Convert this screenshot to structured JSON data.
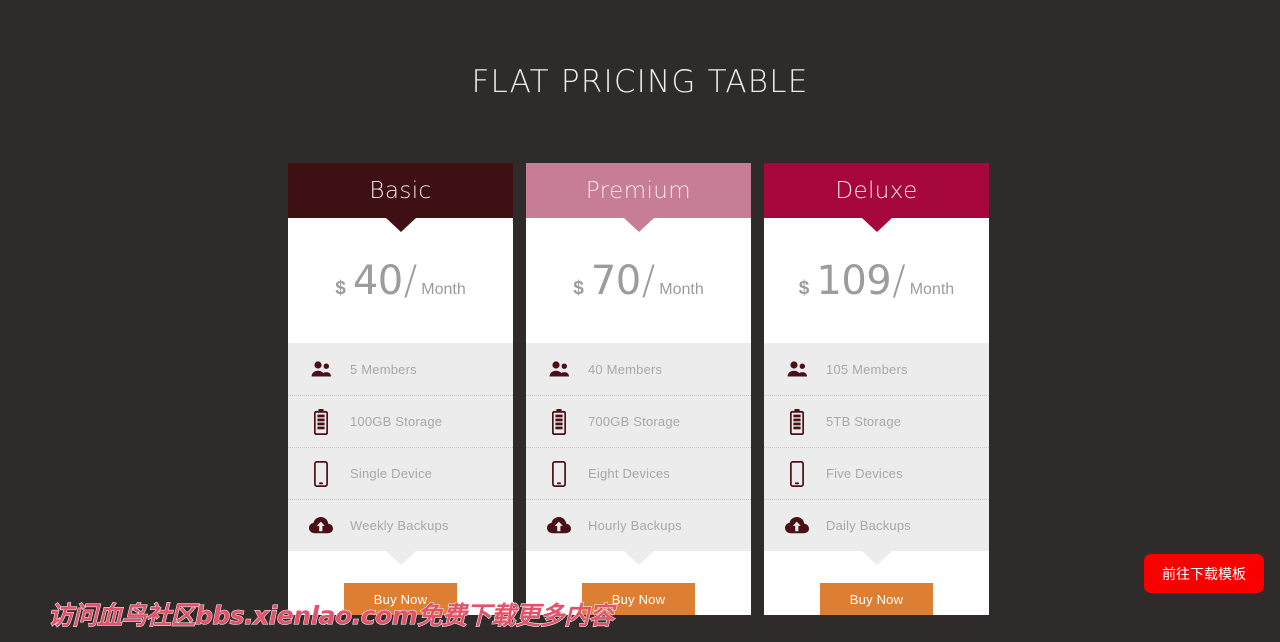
{
  "page": {
    "title": "FLAT PRICING TABLE",
    "background_color": "#2e2b2a"
  },
  "plans": [
    {
      "name": "Basic",
      "header_color": "#3e1014",
      "currency": "$",
      "amount": "40",
      "slash": "/",
      "period": "Month",
      "features": [
        {
          "icon": "users-icon",
          "label": "5 Members"
        },
        {
          "icon": "battery-icon",
          "label": "100GB Storage"
        },
        {
          "icon": "smartphone-icon",
          "label": "Single Device"
        },
        {
          "icon": "cloud-upload-icon",
          "label": "Weekly Backups"
        }
      ],
      "buy_label": "Buy Now"
    },
    {
      "name": "Premium",
      "header_color": "#c67d95",
      "currency": "$",
      "amount": "70",
      "slash": "/",
      "period": "Month",
      "features": [
        {
          "icon": "users-icon",
          "label": "40 Members"
        },
        {
          "icon": "battery-icon",
          "label": "700GB Storage"
        },
        {
          "icon": "smartphone-icon",
          "label": "Eight Devices"
        },
        {
          "icon": "cloud-upload-icon",
          "label": "Hourly Backups"
        }
      ],
      "buy_label": "Buy Now"
    },
    {
      "name": "Deluxe",
      "header_color": "#a5063c",
      "currency": "$",
      "amount": "109",
      "slash": "/",
      "period": "Month",
      "features": [
        {
          "icon": "users-icon",
          "label": "105 Members"
        },
        {
          "icon": "battery-icon",
          "label": "5TB Storage"
        },
        {
          "icon": "smartphone-icon",
          "label": "Five Devices"
        },
        {
          "icon": "cloud-upload-icon",
          "label": "Daily Backups"
        }
      ],
      "buy_label": "Buy Now"
    }
  ],
  "watermark": {
    "text": "访问血鸟社区bbs.xienlao.com免费下载更多内容",
    "color": "#e0536a"
  },
  "download_button": {
    "label": "前往下载模板",
    "color": "#fb0000"
  },
  "colors": {
    "buy_button": "#dd7f32",
    "price_text": "#9c9c9c",
    "feature_text": "#a8a8a8",
    "feature_background": "#ececec",
    "icon_color": "#4a1018"
  }
}
